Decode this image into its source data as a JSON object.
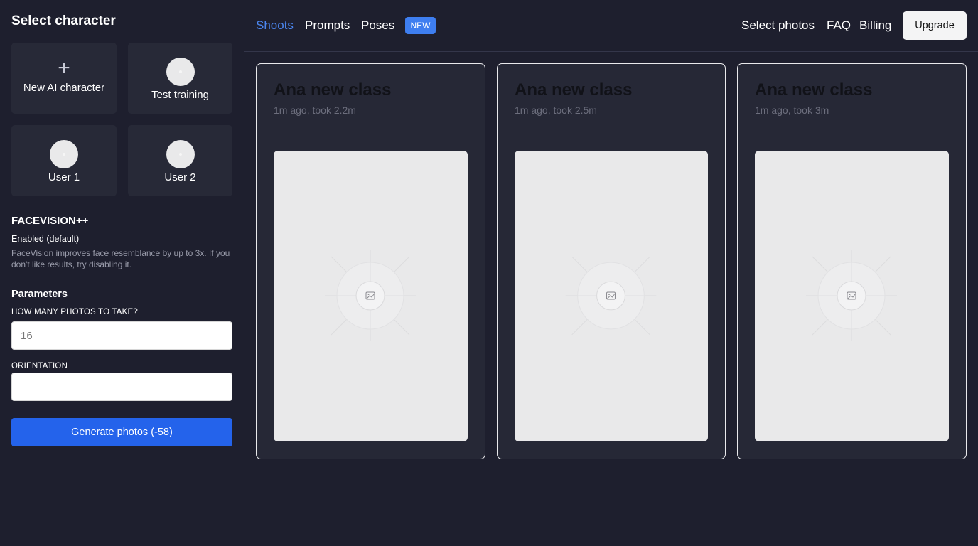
{
  "sidebar": {
    "title": "Select character",
    "characters": [
      {
        "label": "New AI character",
        "type": "new"
      },
      {
        "label": "Test training",
        "type": "avatar"
      },
      {
        "label": "User 1",
        "type": "avatar"
      },
      {
        "label": "User 2",
        "type": "avatar"
      }
    ],
    "facevision": {
      "title": "FACEVISION++",
      "status": "Enabled (default)",
      "description": "FaceVision improves face resemblance by up to 3x. If you don't like results, try disabling it."
    },
    "parameters": {
      "title": "Parameters",
      "photos_label": "HOW MANY PHOTOS TO TAKE?",
      "photos_placeholder": "16",
      "orientation_label": "ORIENTATION",
      "orientation_value": ""
    },
    "generate_label": "Generate photos (-58)"
  },
  "nav": {
    "tabs": [
      {
        "label": "Shoots",
        "active": true
      },
      {
        "label": "Prompts",
        "active": false
      },
      {
        "label": "Poses",
        "active": false
      }
    ],
    "badge": "NEW",
    "links": [
      "Select photos",
      "FAQ",
      "Billing"
    ],
    "upgrade_label": "Upgrade"
  },
  "shoots": [
    {
      "title": "Ana new class",
      "meta": "1m ago, took 2.2m"
    },
    {
      "title": "Ana new class",
      "meta": "1m ago, took 2.5m"
    },
    {
      "title": "Ana new class",
      "meta": "1m ago, took 3m"
    }
  ],
  "colors": {
    "background": "#1e1f2e",
    "card": "#272937",
    "accent": "#2463eb",
    "active_tab": "#4b86f0",
    "badge": "#3e7ef0"
  }
}
